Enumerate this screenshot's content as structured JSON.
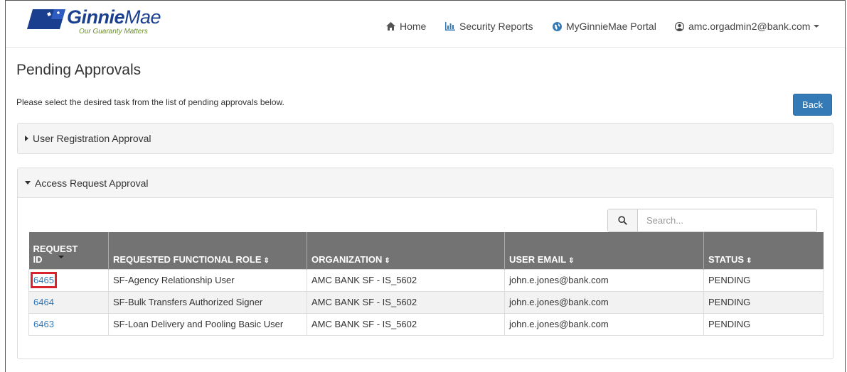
{
  "header": {
    "logo_bold": "Ginnie",
    "logo_light": "Mae",
    "logo_tagline": "Our Guaranty Matters",
    "nav": {
      "home": "Home",
      "reports": "Security Reports",
      "portal": "MyGinnieMae Portal",
      "user": "amc.orgadmin2@bank.com"
    }
  },
  "page": {
    "title": "Pending Approvals",
    "intro": "Please select the desired task from the list of pending approvals below.",
    "back_label": "Back"
  },
  "panels": {
    "user_registration": "User Registration Approval",
    "access_request": "Access Request Approval"
  },
  "search": {
    "placeholder": "Search..."
  },
  "table": {
    "headers": {
      "id_line1": "REQUEST",
      "id_line2": "ID",
      "role": "REQUESTED FUNCTIONAL ROLE",
      "org": "ORGANIZATION",
      "email": "USER EMAIL",
      "status": "STATUS",
      "sort_glyph": "⇕"
    },
    "rows": [
      {
        "id": "6465",
        "role": "SF-Agency Relationship User",
        "org": "AMC BANK SF - IS_5602",
        "email": "john.e.jones@bank.com",
        "status": "PENDING"
      },
      {
        "id": "6464",
        "role": "SF-Bulk Transfers Authorized Signer",
        "org": "AMC BANK SF - IS_5602",
        "email": "john.e.jones@bank.com",
        "status": "PENDING"
      },
      {
        "id": "6463",
        "role": "SF-Loan Delivery and Pooling Basic User",
        "org": "AMC BANK SF - IS_5602",
        "email": "john.e.jones@bank.com",
        "status": "PENDING"
      }
    ]
  },
  "colors": {
    "brand_blue": "#1b3f8f",
    "link_blue": "#337ab7",
    "header_grey": "#737373",
    "highlight_red": "#d9232e"
  },
  "icons": [
    "home-icon",
    "bar-chart-icon",
    "globe-icon",
    "user-circle-icon",
    "search-icon"
  ]
}
